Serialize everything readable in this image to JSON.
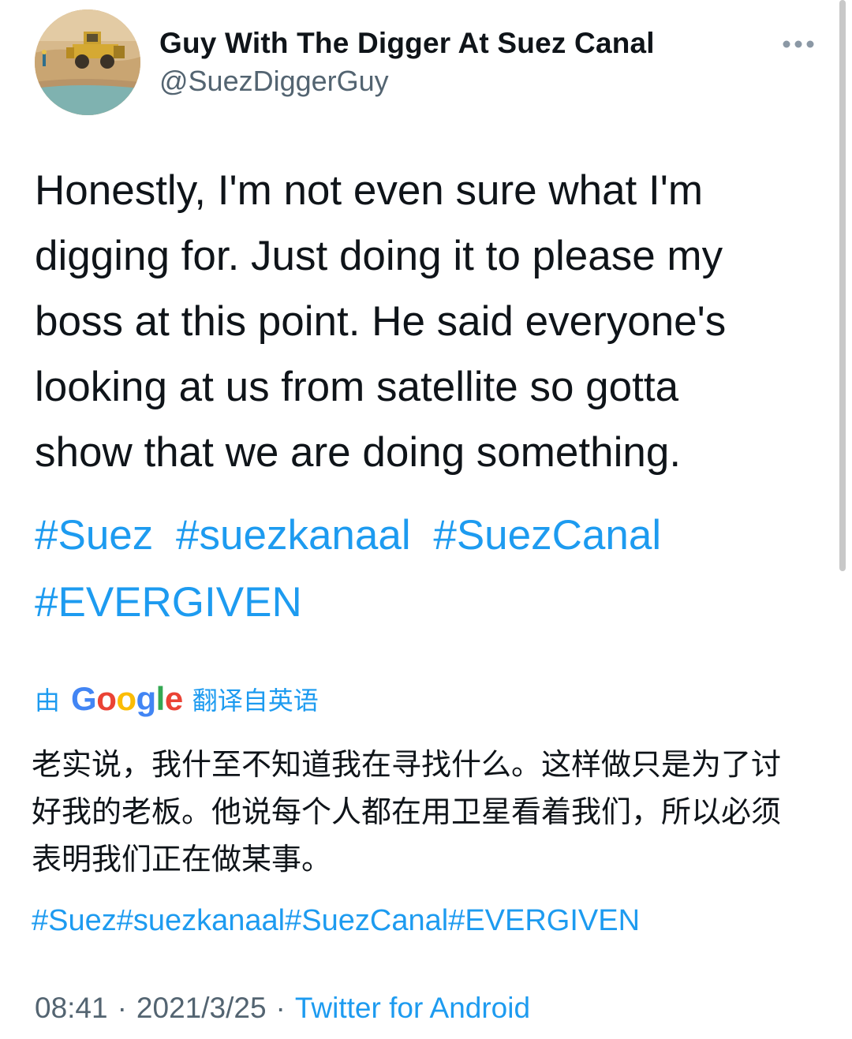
{
  "user": {
    "display_name": "Guy With The Digger At Suez Canal",
    "handle": "@SuezDiggerGuy",
    "avatar_icon": "bulldozer-photo"
  },
  "menu": {
    "more_icon": "more-horizontal-icon"
  },
  "tweet": {
    "text_lines": [
      "Honestly, I'm not even sure what I'm",
      "digging for. Just doing it to please my",
      "boss at this point. He said everyone's",
      "looking at us from satellite so gotta",
      "show that we are doing something."
    ],
    "hashtags": [
      "#Suez",
      "#suezkanaal",
      "#SuezCanal",
      "#EVERGIVEN"
    ]
  },
  "translation": {
    "prefix": "由",
    "provider": "Google",
    "suffix": "翻译自英语",
    "text_lines": [
      "老实说，我什至不知道我在寻找什么。这样做只是为了讨",
      "好我的老板。他说每个人都在用卫星看着我们，所以必须",
      "表明我们正在做某事。"
    ],
    "hashtags": [
      "#Suez",
      "#suezkanaal",
      "#SuezCanal",
      "#EVERGIVEN"
    ]
  },
  "meta": {
    "time": "08:41",
    "separator": "·",
    "date": "2021/3/25",
    "source": "Twitter for Android"
  },
  "colors": {
    "link": "#1d9bf0",
    "secondary_text": "#536471",
    "primary_text": "#0f1419"
  }
}
